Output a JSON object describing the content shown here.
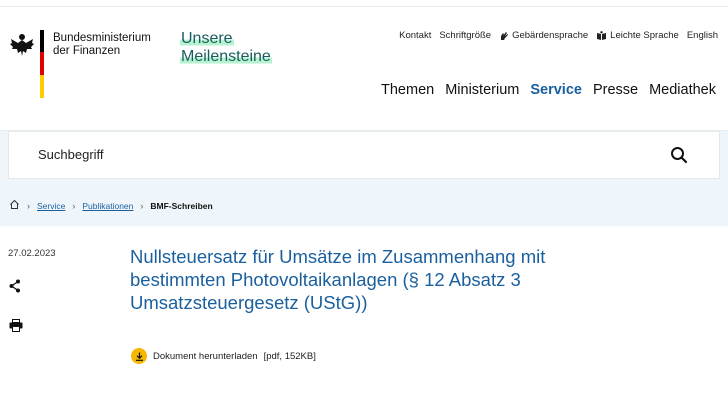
{
  "header": {
    "ministry_line1": "Bundesministerium",
    "ministry_line2": "der Finanzen",
    "campaign_line1": "Unsere",
    "campaign_line2": "Meilensteine",
    "utility": {
      "contact": "Kontakt",
      "font_size": "Schriftgröße",
      "sign_language": "Gebärdensprache",
      "easy_language": "Leichte Sprache",
      "english": "English"
    },
    "nav": [
      "Themen",
      "Ministerium",
      "Service",
      "Presse",
      "Mediathek"
    ],
    "active_nav": "Service"
  },
  "search": {
    "placeholder": "Suchbegriff"
  },
  "breadcrumb": {
    "items": [
      "Service",
      "Publikationen"
    ],
    "current": "BMF-Schreiben"
  },
  "article": {
    "date": "27.02.2023",
    "title": "Nullsteuersatz für Umsätze im Zusammenhang mit bestimmten Photovoltaikanlagen (§ 12 Absatz 3 Umsatzsteuergesetz (UStG))",
    "download_label": "Dokument herunterladen",
    "download_meta": "[pdf, 152KB]"
  },
  "colors": {
    "link_blue": "#1a5f9e",
    "highlight_green": "#b6f2cf",
    "band_bg": "#eef6fb",
    "download_badge": "#f5b700",
    "flag": [
      "#000000",
      "#dd0000",
      "#ffcc00"
    ]
  },
  "icons": [
    "eagle-logo",
    "sign-language-icon",
    "easy-language-icon",
    "search-icon",
    "home-icon",
    "share-icon",
    "print-icon",
    "download-icon"
  ]
}
